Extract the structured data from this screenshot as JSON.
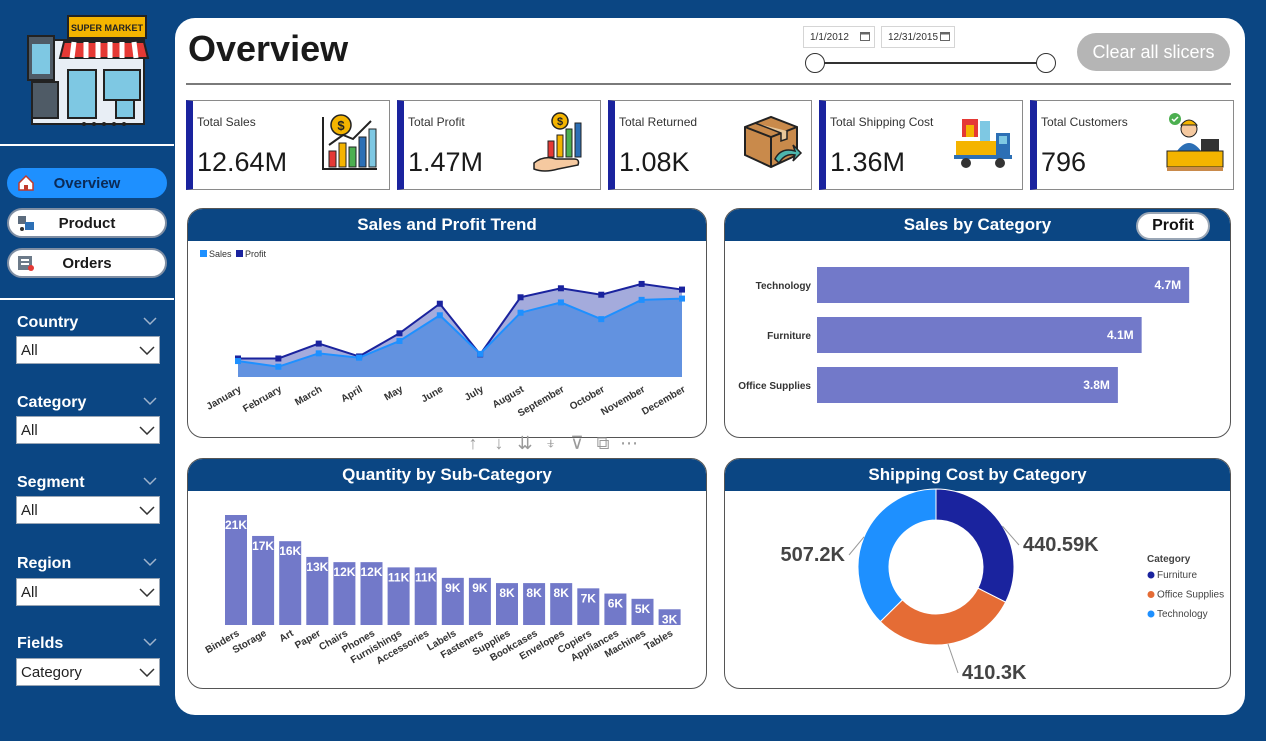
{
  "logo": {
    "text": "SUPER MARKET"
  },
  "nav": [
    {
      "label": "Overview",
      "icon": "home-icon",
      "active": true
    },
    {
      "label": "Product",
      "icon": "product-icon",
      "active": false
    },
    {
      "label": "Orders",
      "icon": "orders-icon",
      "active": false
    }
  ],
  "slicers": [
    {
      "label": "Country",
      "value": "All"
    },
    {
      "label": "Category",
      "value": "All"
    },
    {
      "label": "Segment",
      "value": "All"
    },
    {
      "label": "Region",
      "value": "All"
    },
    {
      "label": "Fields",
      "value": "Category"
    }
  ],
  "header": {
    "title": "Overview",
    "date_start": "1/1/2012",
    "date_end": "12/31/2015",
    "clear_label": "Clear all slicers"
  },
  "kpis": [
    {
      "label": "Total Sales",
      "value": "12.64M",
      "icon": "sales-chart-icon"
    },
    {
      "label": "Total Profit",
      "value": "1.47M",
      "icon": "profit-hand-icon"
    },
    {
      "label": "Total Returned",
      "value": "1.08K",
      "icon": "return-box-icon"
    },
    {
      "label": "Total Shipping Cost",
      "value": "1.36M",
      "icon": "delivery-truck-icon"
    },
    {
      "label": "Total Customers",
      "value": "796",
      "icon": "customer-desk-icon"
    }
  ],
  "panels": {
    "trend_title": "Sales and Profit Trend",
    "category_title": "Sales by Category",
    "category_toggle": "Profit",
    "subcat_title": "Quantity by Sub-Category",
    "shipping_title": "Shipping Cost by Category"
  },
  "colors": {
    "navy": "#0b4683",
    "sales": "#1e90ff",
    "profit": "#1a239e",
    "bar": "#7279c9",
    "furniture": "#1a239e",
    "office": "#e56c35",
    "technology": "#1e90ff"
  },
  "chart_data": [
    {
      "type": "area",
      "categories": [
        "January",
        "February",
        "March",
        "April",
        "May",
        "June",
        "July",
        "August",
        "September",
        "October",
        "November",
        "December"
      ],
      "series": [
        {
          "name": "Sales",
          "values": [
            0.62,
            0.4,
            0.92,
            0.75,
            1.4,
            2.4,
            0.9,
            2.5,
            2.9,
            2.25,
            3.0,
            3.05
          ]
        },
        {
          "name": "Profit",
          "values": [
            0.72,
            0.72,
            1.3,
            0.8,
            1.7,
            2.85,
            0.88,
            3.1,
            3.45,
            3.2,
            3.62,
            3.4
          ]
        }
      ],
      "legend": "top-left"
    },
    {
      "type": "bar",
      "orientation": "horizontal",
      "categories": [
        "Technology",
        "Furniture",
        "Office Supplies"
      ],
      "values": [
        4.7,
        4.1,
        3.8
      ],
      "labels": [
        "4.7M",
        "4.1M",
        "3.8M"
      ]
    },
    {
      "type": "bar",
      "categories": [
        "Binders",
        "Storage",
        "Art",
        "Paper",
        "Chairs",
        "Phones",
        "Furnishings",
        "Accessories",
        "Labels",
        "Fasteners",
        "Supplies",
        "Bookcases",
        "Envelopes",
        "Copiers",
        "Appliances",
        "Machines",
        "Tables"
      ],
      "values": [
        21,
        17,
        16,
        13,
        12,
        12,
        11,
        11,
        9,
        9,
        8,
        8,
        8,
        7,
        6,
        5,
        3
      ],
      "labels": [
        "21K",
        "17K",
        "16K",
        "13K",
        "12K",
        "12K",
        "11K",
        "11K",
        "9K",
        "9K",
        "8K",
        "8K",
        "8K",
        "7K",
        "6K",
        "5K",
        "3K"
      ]
    },
    {
      "type": "pie",
      "donut": true,
      "legend_title": "Category",
      "categories": [
        "Furniture",
        "Office Supplies",
        "Technology"
      ],
      "values": [
        440.59,
        410.3,
        507.2
      ],
      "labels": [
        "440.59K",
        "410.3K",
        "507.2K"
      ],
      "legend": "right"
    }
  ]
}
